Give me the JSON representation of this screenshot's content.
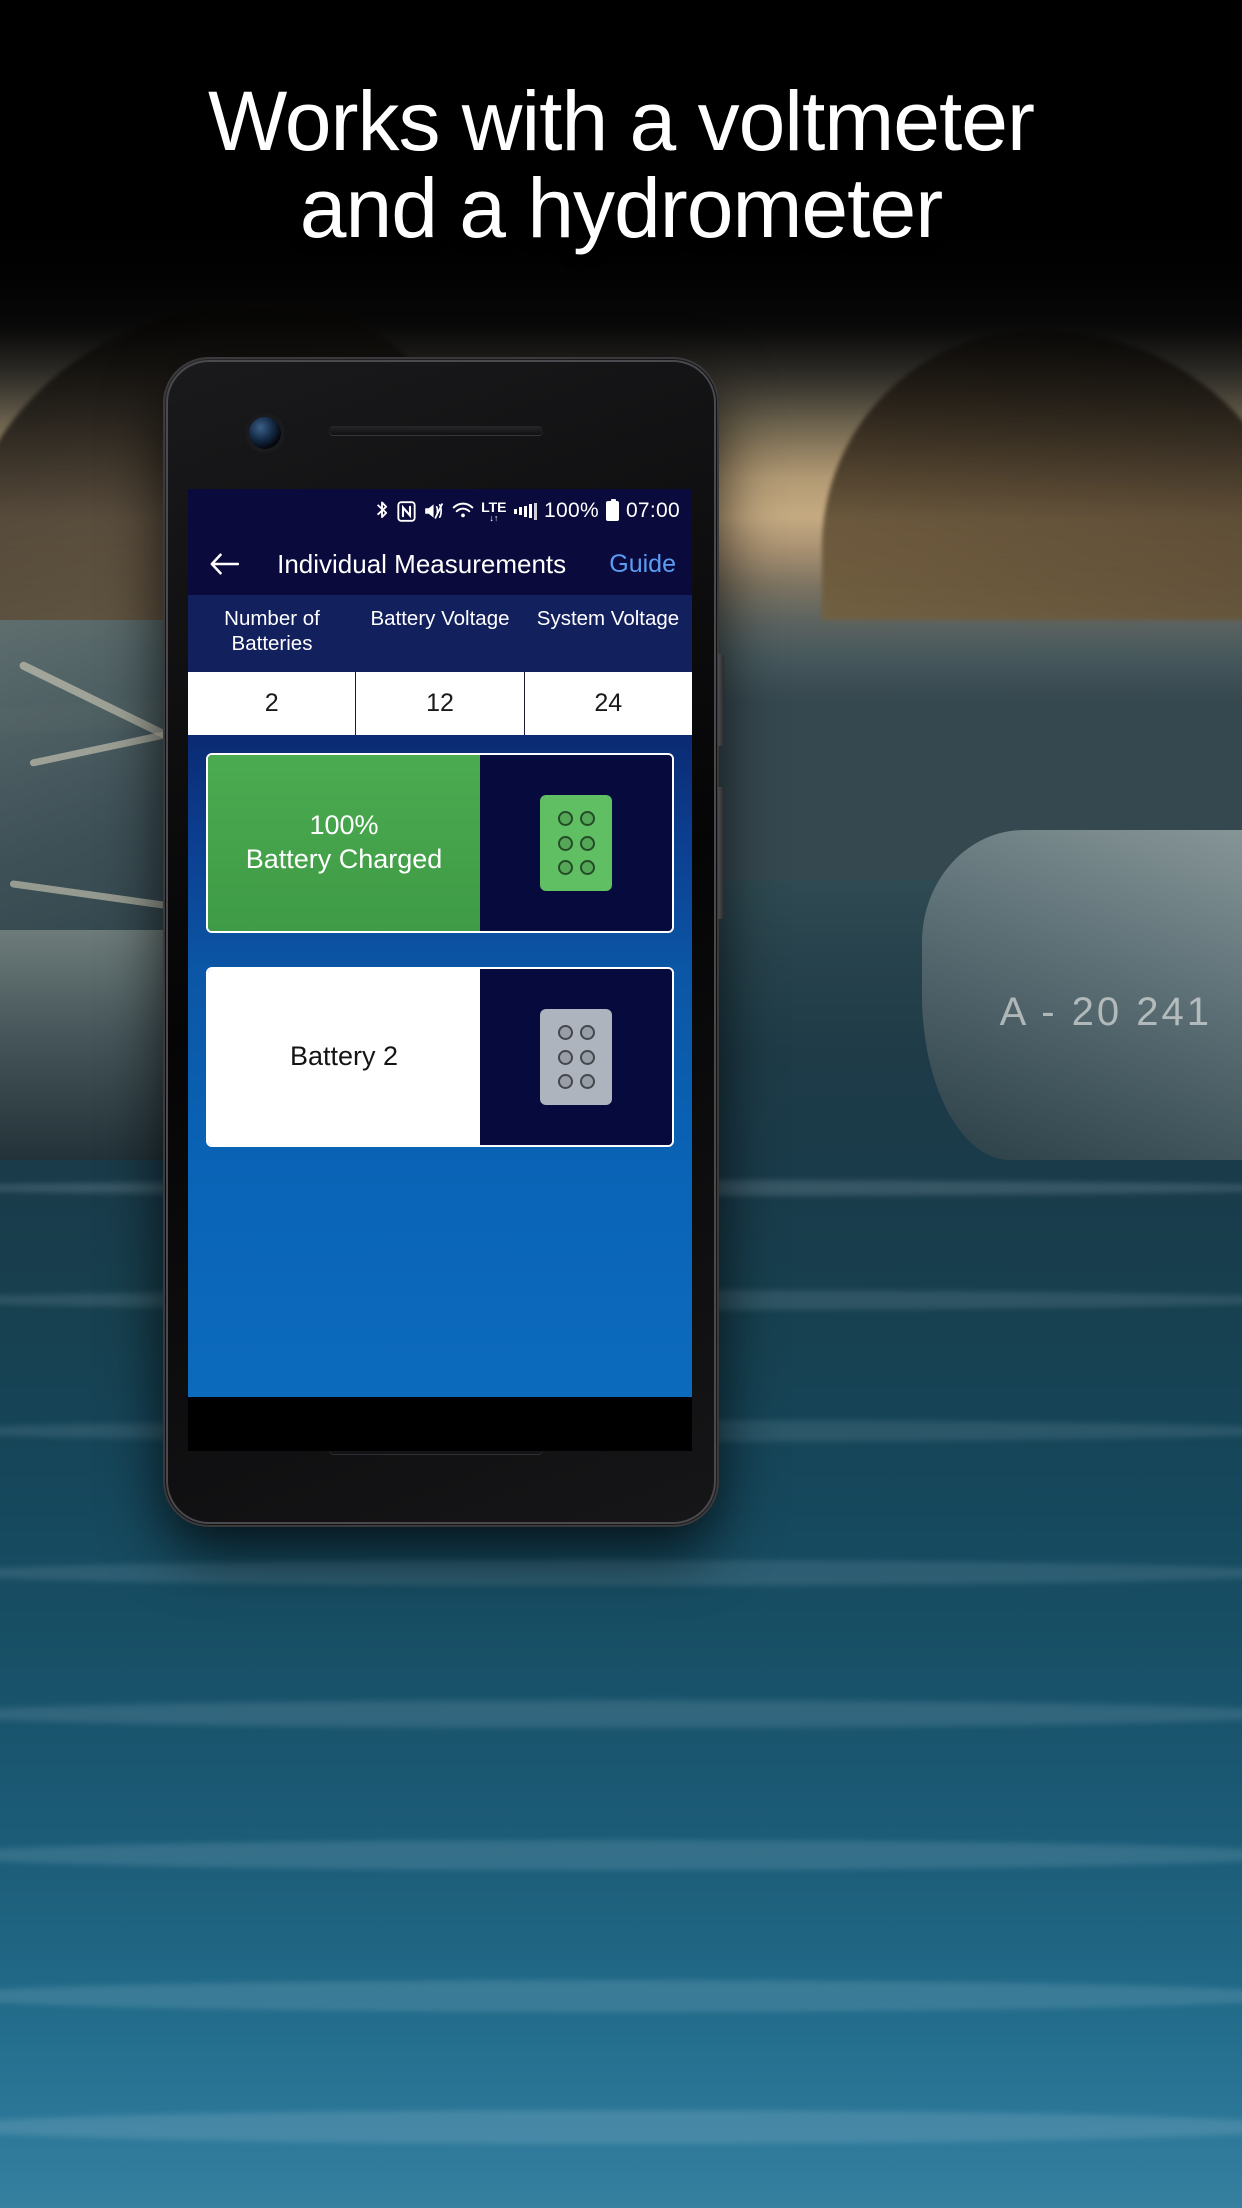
{
  "promo": {
    "headline_line1": "Works with a voltmeter",
    "headline_line2": "and a hydrometer"
  },
  "background": {
    "boat_registration_text": "A - 20 241"
  },
  "phone": {
    "statusbar": {
      "icons": [
        "bluetooth-icon",
        "nfc-icon",
        "mute-icon",
        "wifi-icon",
        "lte-icon",
        "signal-bars-icon",
        "battery-icon"
      ],
      "lte_label": "LTE",
      "battery_percent": "100%",
      "time": "07:00"
    },
    "appbar": {
      "back_label": "←",
      "title": "Individual Measurements",
      "action_label": "Guide",
      "action_color": "#5b9df4"
    },
    "table": {
      "headers": [
        "Number of Batteries",
        "Battery Voltage",
        "System Voltage"
      ],
      "values": [
        "2",
        "12",
        "24"
      ]
    },
    "cards": [
      {
        "name": "battery-1",
        "line1": "100%",
        "line2": "Battery Charged",
        "label_bg": "#4bab50",
        "icon": "battery-cell-icon",
        "icon_state": "charged"
      },
      {
        "name": "battery-2",
        "line1": "Battery 2",
        "line2": "",
        "label_bg": "#ffffff",
        "icon": "battery-cell-icon",
        "icon_state": "unmeasured"
      }
    ]
  },
  "colors": {
    "statusbar_bg": "#0a0a3c",
    "appbar_bg": "#0a0a3c",
    "table_head_bg": "#12205e",
    "body_blue": "#0b5cab",
    "card_green": "#4bab50",
    "card_icon_bg": "#060a3c"
  }
}
